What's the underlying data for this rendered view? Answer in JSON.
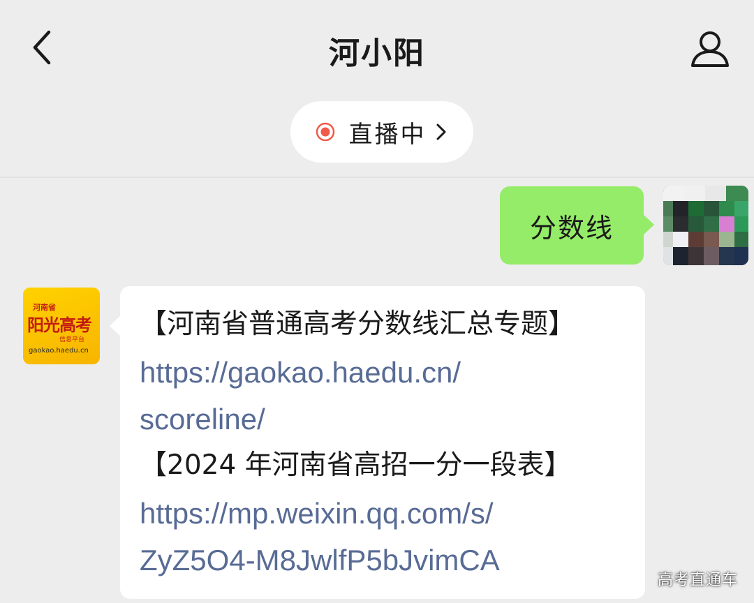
{
  "header": {
    "title": "河小阳",
    "back_icon": "chevron-left-icon",
    "profile_icon": "person-icon"
  },
  "live_banner": {
    "label": "直播中",
    "status_icon": "live-dot-icon",
    "chevron_icon": "chevron-right-icon",
    "accent_color": "#f05a4a"
  },
  "messages": [
    {
      "direction": "outgoing",
      "text": "分数线",
      "bubble_color": "#95ec69",
      "avatar": "pixelated-user-avatar"
    },
    {
      "direction": "incoming",
      "avatar": {
        "line1": "河南省",
        "line2": "阳光高考",
        "line3": "信息平台",
        "line4": "gaokao.haedu.cn"
      },
      "lines": [
        {
          "kind": "heading",
          "text": "【河南省普通高考分数线汇总专题】"
        },
        {
          "kind": "link",
          "text": "https://gaokao.haedu.cn/"
        },
        {
          "kind": "link",
          "text": "scoreline/"
        },
        {
          "kind": "heading",
          "text": "【2024 年河南省高招一分一段表】"
        },
        {
          "kind": "link",
          "text": "https://mp.weixin.qq.com/s/"
        },
        {
          "kind": "link",
          "text": "ZyZ5O4-M8JwlfP5bJvimCA"
        }
      ]
    }
  ],
  "watermark": "高考直通车",
  "colors": {
    "background": "#ededed",
    "link": "#586b95",
    "avatar_yellow": "#ffd200",
    "avatar_red": "#c41b12"
  }
}
